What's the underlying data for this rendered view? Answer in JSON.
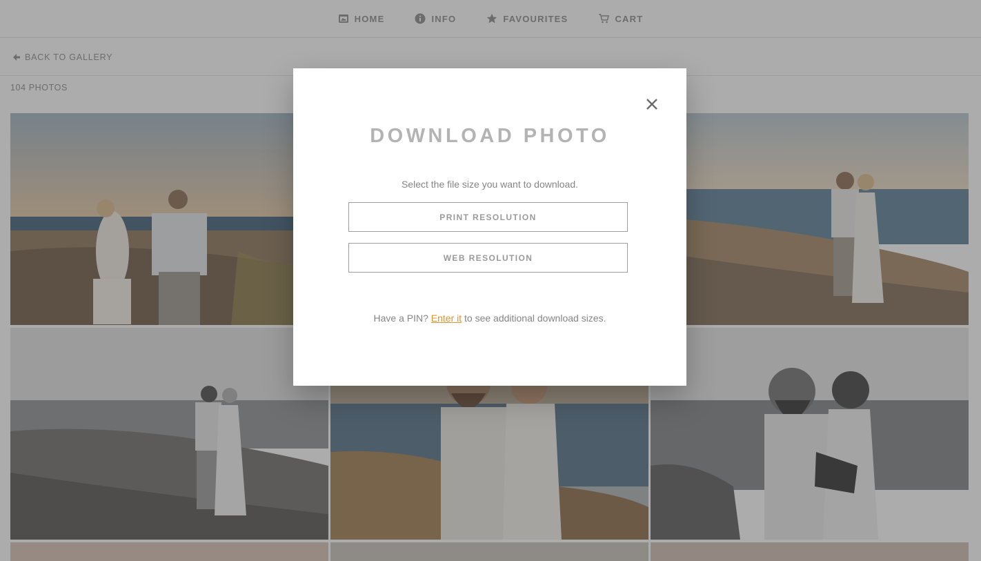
{
  "nav": {
    "items": [
      {
        "label": "HOME",
        "icon": "home-icon"
      },
      {
        "label": "INFO",
        "icon": "info-icon"
      },
      {
        "label": "FAVOURITES",
        "icon": "star-icon"
      },
      {
        "label": "CART",
        "icon": "cart-icon"
      }
    ]
  },
  "subbar": {
    "back_label": "BACK TO GALLERY"
  },
  "gallery": {
    "photo_count": "104 PHOTOS"
  },
  "modal": {
    "title": "DOWNLOAD PHOTO",
    "subtitle": "Select the file size you want to download.",
    "print_label": "PRINT RESOLUTION",
    "web_label": "WEB RESOLUTION",
    "pin_prefix": "Have a PIN? ",
    "pin_link": "Enter it",
    "pin_suffix": " to see additional download sizes."
  },
  "colors": {
    "accent_link": "#e0932f",
    "overlay": "rgba(70,70,70,0.45)"
  }
}
